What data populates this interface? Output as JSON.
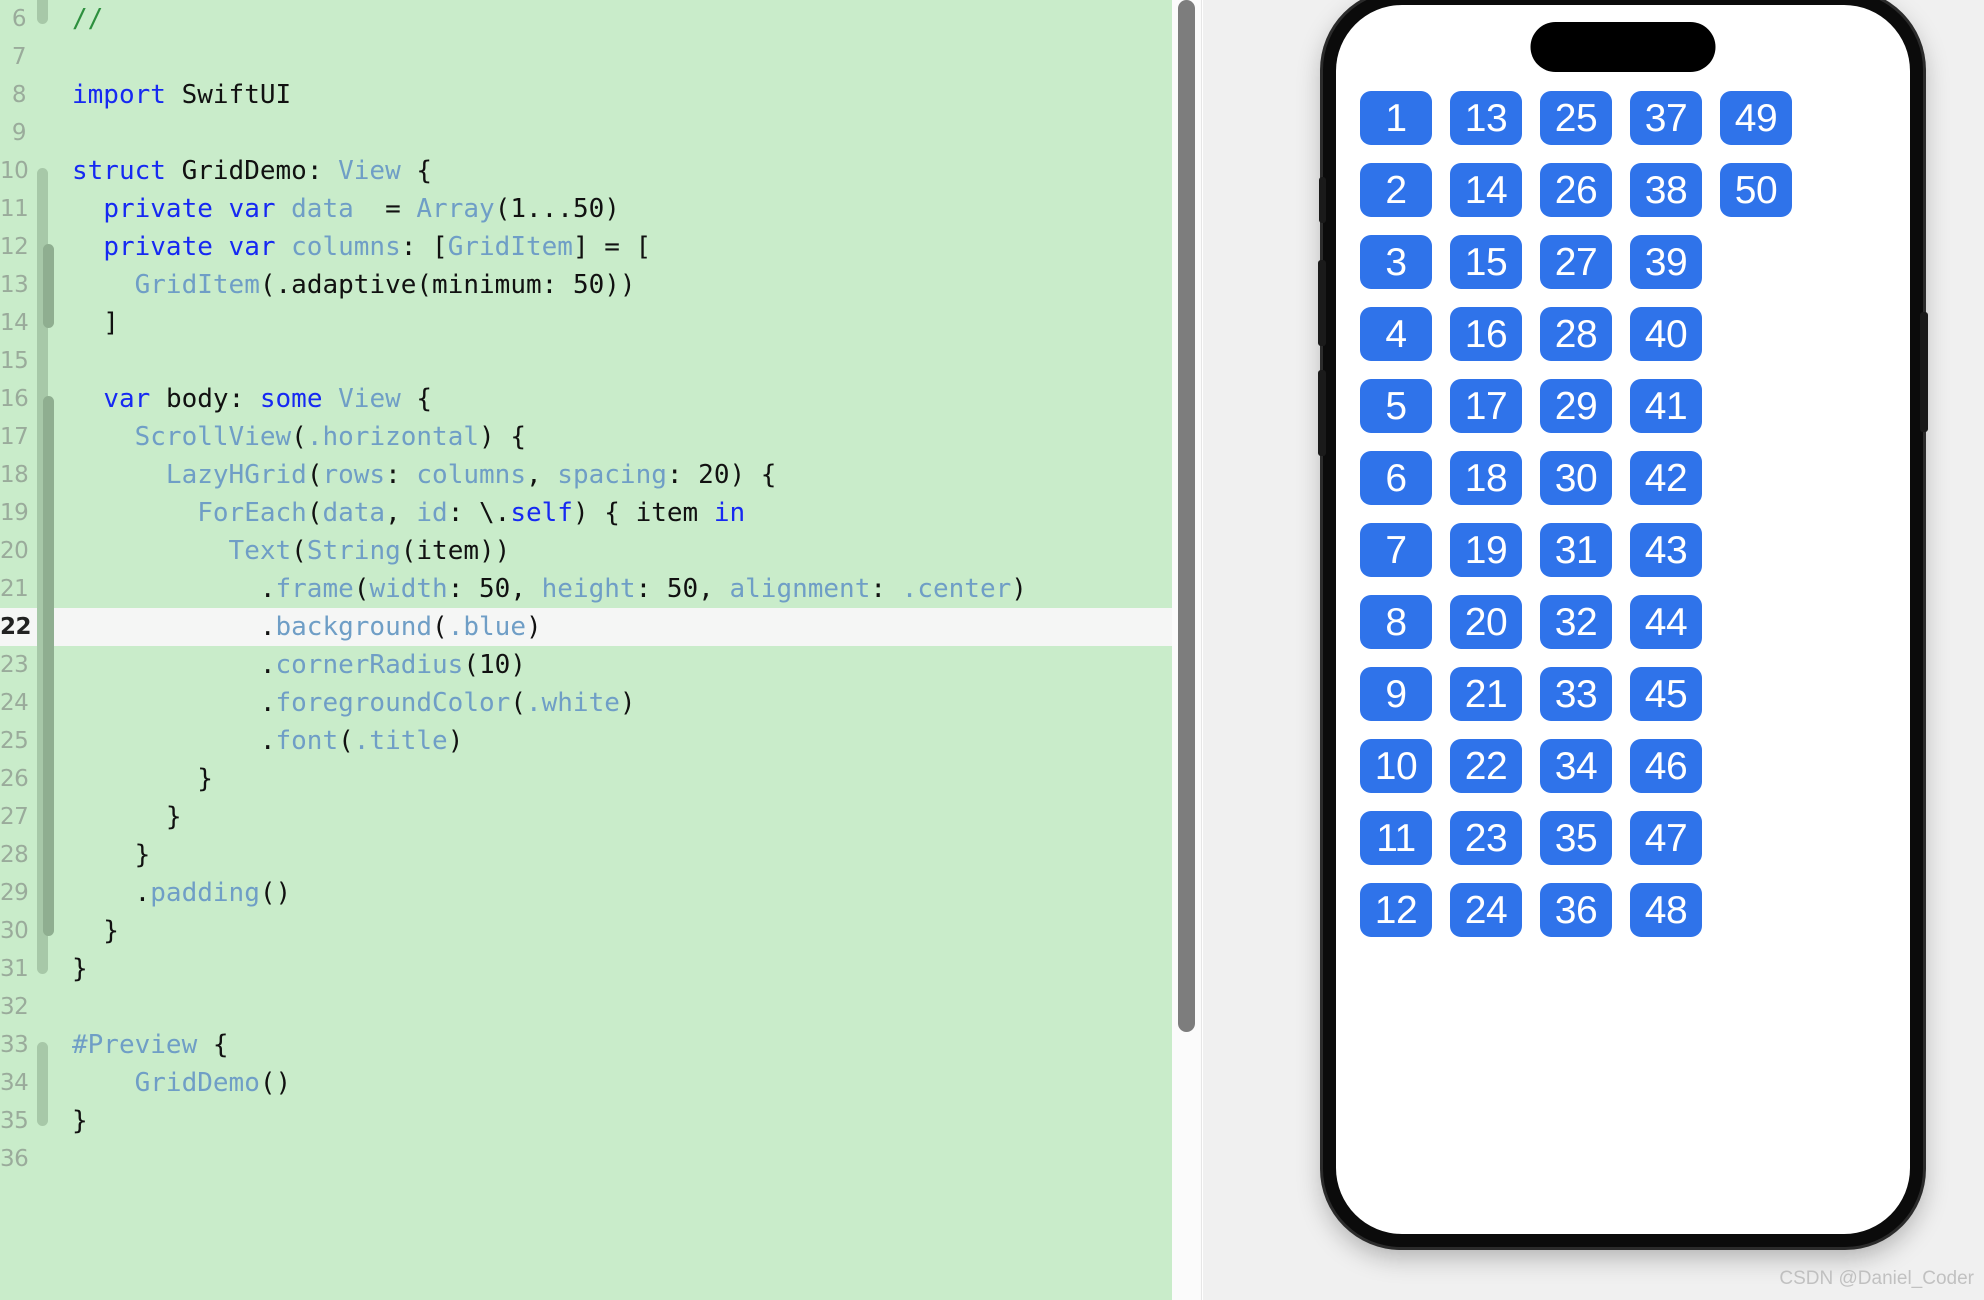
{
  "editor": {
    "first_line_number": 6,
    "highlighted_line": 22,
    "background_color": "#c9ecca",
    "highlight_color": "#f5f6f5",
    "lines": [
      {
        "n": 6,
        "tokens": [
          {
            "t": "//",
            "c": "cm"
          }
        ],
        "guides": [
          "d1-bot"
        ]
      },
      {
        "n": 7,
        "tokens": [],
        "guides": []
      },
      {
        "n": 8,
        "tokens": [
          {
            "t": "import ",
            "c": "kw"
          },
          {
            "t": "SwiftUI",
            "c": "pl"
          }
        ],
        "guides": []
      },
      {
        "n": 9,
        "tokens": [],
        "guides": []
      },
      {
        "n": 10,
        "tokens": [
          {
            "t": "struct ",
            "c": "kw"
          },
          {
            "t": "GridDemo",
            "c": "pl"
          },
          {
            "t": ": ",
            "c": "pl"
          },
          {
            "t": "View",
            "c": "ty"
          },
          {
            "t": " {",
            "c": "pl"
          }
        ],
        "guides": [
          "d1-top"
        ]
      },
      {
        "n": 11,
        "tokens": [
          {
            "t": "  ",
            "c": "pl"
          },
          {
            "t": "private var ",
            "c": "kw"
          },
          {
            "t": "data",
            "c": "ty"
          },
          {
            "t": "  = ",
            "c": "pl"
          },
          {
            "t": "Array",
            "c": "ty"
          },
          {
            "t": "(1...50)",
            "c": "pl"
          }
        ],
        "guides": [
          "d1-mid"
        ]
      },
      {
        "n": 12,
        "tokens": [
          {
            "t": "  ",
            "c": "pl"
          },
          {
            "t": "private var ",
            "c": "kw"
          },
          {
            "t": "columns",
            "c": "ty"
          },
          {
            "t": ": [",
            "c": "pl"
          },
          {
            "t": "GridItem",
            "c": "ty"
          },
          {
            "t": "] = [",
            "c": "pl"
          }
        ],
        "guides": [
          "d1-mid",
          "d2-top"
        ]
      },
      {
        "n": 13,
        "tokens": [
          {
            "t": "    ",
            "c": "pl"
          },
          {
            "t": "GridItem",
            "c": "ty"
          },
          {
            "t": "(.",
            "c": "pl"
          },
          {
            "t": "adaptive",
            "c": "pl"
          },
          {
            "t": "(minimum: 50))",
            "c": "pl"
          }
        ],
        "guides": [
          "d1-mid",
          "d2-mid"
        ]
      },
      {
        "n": 14,
        "tokens": [
          {
            "t": "  ]",
            "c": "pl"
          }
        ],
        "guides": [
          "d1-mid",
          "d2-bot"
        ]
      },
      {
        "n": 15,
        "tokens": [],
        "guides": [
          "d1-mid"
        ]
      },
      {
        "n": 16,
        "tokens": [
          {
            "t": "  ",
            "c": "pl"
          },
          {
            "t": "var ",
            "c": "kw"
          },
          {
            "t": "body",
            "c": "pl"
          },
          {
            "t": ": ",
            "c": "pl"
          },
          {
            "t": "some ",
            "c": "kw"
          },
          {
            "t": "View",
            "c": "ty"
          },
          {
            "t": " {",
            "c": "pl"
          }
        ],
        "guides": [
          "d1-mid",
          "d2-top"
        ]
      },
      {
        "n": 17,
        "tokens": [
          {
            "t": "    ",
            "c": "pl"
          },
          {
            "t": "ScrollView",
            "c": "ty"
          },
          {
            "t": "(",
            "c": "pl"
          },
          {
            "t": ".horizontal",
            "c": "ty"
          },
          {
            "t": ") {",
            "c": "pl"
          }
        ],
        "guides": [
          "d1-mid",
          "d2-mid"
        ]
      },
      {
        "n": 18,
        "tokens": [
          {
            "t": "      ",
            "c": "pl"
          },
          {
            "t": "LazyHGrid",
            "c": "ty"
          },
          {
            "t": "(",
            "c": "pl"
          },
          {
            "t": "rows",
            "c": "ty"
          },
          {
            "t": ": ",
            "c": "pl"
          },
          {
            "t": "columns",
            "c": "ty"
          },
          {
            "t": ", ",
            "c": "pl"
          },
          {
            "t": "spacing",
            "c": "ty"
          },
          {
            "t": ": 20) {",
            "c": "pl"
          }
        ],
        "guides": [
          "d1-mid",
          "d2-mid"
        ]
      },
      {
        "n": 19,
        "tokens": [
          {
            "t": "        ",
            "c": "pl"
          },
          {
            "t": "ForEach",
            "c": "ty"
          },
          {
            "t": "(",
            "c": "pl"
          },
          {
            "t": "data",
            "c": "ty"
          },
          {
            "t": ", ",
            "c": "pl"
          },
          {
            "t": "id",
            "c": "ty"
          },
          {
            "t": ": \\.",
            "c": "pl"
          },
          {
            "t": "self",
            "c": "kw"
          },
          {
            "t": ") { item ",
            "c": "pl"
          },
          {
            "t": "in",
            "c": "kw"
          }
        ],
        "guides": [
          "d1-mid",
          "d2-mid"
        ]
      },
      {
        "n": 20,
        "tokens": [
          {
            "t": "          ",
            "c": "pl"
          },
          {
            "t": "Text",
            "c": "ty"
          },
          {
            "t": "(",
            "c": "pl"
          },
          {
            "t": "String",
            "c": "ty"
          },
          {
            "t": "(item))",
            "c": "pl"
          }
        ],
        "guides": [
          "d1-mid",
          "d2-mid"
        ]
      },
      {
        "n": 21,
        "tokens": [
          {
            "t": "            .",
            "c": "pl"
          },
          {
            "t": "frame",
            "c": "ty"
          },
          {
            "t": "(",
            "c": "pl"
          },
          {
            "t": "width",
            "c": "ty"
          },
          {
            "t": ": 50, ",
            "c": "pl"
          },
          {
            "t": "height",
            "c": "ty"
          },
          {
            "t": ": 50, ",
            "c": "pl"
          },
          {
            "t": "alignment",
            "c": "ty"
          },
          {
            "t": ": ",
            "c": "pl"
          },
          {
            "t": ".center",
            "c": "ty"
          },
          {
            "t": ")",
            "c": "pl"
          }
        ],
        "guides": [
          "d1-mid",
          "d2-mid"
        ]
      },
      {
        "n": 22,
        "tokens": [
          {
            "t": "            .",
            "c": "pl"
          },
          {
            "t": "background",
            "c": "ty"
          },
          {
            "t": "(",
            "c": "pl"
          },
          {
            "t": ".blue",
            "c": "ty"
          },
          {
            "t": ")",
            "c": "pl"
          }
        ],
        "guides": [
          "d1-mid",
          "d2-mid"
        ]
      },
      {
        "n": 23,
        "tokens": [
          {
            "t": "            .",
            "c": "pl"
          },
          {
            "t": "cornerRadius",
            "c": "ty"
          },
          {
            "t": "(10)",
            "c": "pl"
          }
        ],
        "guides": [
          "d1-mid",
          "d2-mid"
        ]
      },
      {
        "n": 24,
        "tokens": [
          {
            "t": "            .",
            "c": "pl"
          },
          {
            "t": "foregroundColor",
            "c": "ty"
          },
          {
            "t": "(",
            "c": "pl"
          },
          {
            "t": ".white",
            "c": "ty"
          },
          {
            "t": ")",
            "c": "pl"
          }
        ],
        "guides": [
          "d1-mid",
          "d2-mid"
        ]
      },
      {
        "n": 25,
        "tokens": [
          {
            "t": "            .",
            "c": "pl"
          },
          {
            "t": "font",
            "c": "ty"
          },
          {
            "t": "(",
            "c": "pl"
          },
          {
            "t": ".title",
            "c": "ty"
          },
          {
            "t": ")",
            "c": "pl"
          }
        ],
        "guides": [
          "d1-mid",
          "d2-mid"
        ]
      },
      {
        "n": 26,
        "tokens": [
          {
            "t": "        }",
            "c": "pl"
          }
        ],
        "guides": [
          "d1-mid",
          "d2-mid"
        ]
      },
      {
        "n": 27,
        "tokens": [
          {
            "t": "      }",
            "c": "pl"
          }
        ],
        "guides": [
          "d1-mid",
          "d2-mid"
        ]
      },
      {
        "n": 28,
        "tokens": [
          {
            "t": "    }",
            "c": "pl"
          }
        ],
        "guides": [
          "d1-mid",
          "d2-mid"
        ]
      },
      {
        "n": 29,
        "tokens": [
          {
            "t": "    .",
            "c": "pl"
          },
          {
            "t": "padding",
            "c": "ty"
          },
          {
            "t": "()",
            "c": "pl"
          }
        ],
        "guides": [
          "d1-mid",
          "d2-mid"
        ]
      },
      {
        "n": 30,
        "tokens": [
          {
            "t": "  }",
            "c": "pl"
          }
        ],
        "guides": [
          "d1-mid",
          "d2-bot"
        ]
      },
      {
        "n": 31,
        "tokens": [
          {
            "t": "}",
            "c": "pl"
          }
        ],
        "guides": [
          "d1-bot"
        ]
      },
      {
        "n": 32,
        "tokens": [],
        "guides": []
      },
      {
        "n": 33,
        "tokens": [
          {
            "t": "#Preview",
            "c": "ty"
          },
          {
            "t": " {",
            "c": "pl"
          }
        ],
        "guides": [
          "d1-top"
        ]
      },
      {
        "n": 34,
        "tokens": [
          {
            "t": "    ",
            "c": "pl"
          },
          {
            "t": "GridDemo",
            "c": "ty"
          },
          {
            "t": "()",
            "c": "pl"
          }
        ],
        "guides": [
          "d1-mid"
        ]
      },
      {
        "n": 35,
        "tokens": [
          {
            "t": "}",
            "c": "pl"
          }
        ],
        "guides": [
          "d1-bot"
        ]
      },
      {
        "n": 36,
        "tokens": [],
        "guides": []
      }
    ]
  },
  "scrollbar": {
    "orientation": "vertical",
    "thumb_color": "#7d7d7d",
    "track_color": "#fbfbfb"
  },
  "preview": {
    "background_color": "#f0f0f0",
    "device": "iPhone",
    "tile_color": "#2f73ea",
    "tile_text_color": "#ffffff",
    "grid": {
      "columns": [
        [
          1,
          2,
          3,
          4,
          5,
          6,
          7,
          8,
          9,
          10,
          11,
          12
        ],
        [
          13,
          14,
          15,
          16,
          17,
          18,
          19,
          20,
          21,
          22,
          23,
          24
        ],
        [
          25,
          26,
          27,
          28,
          29,
          30,
          31,
          32,
          33,
          34,
          35,
          36
        ],
        [
          37,
          38,
          39,
          40,
          41,
          42,
          43,
          44,
          45,
          46,
          47,
          48
        ],
        [
          49,
          50
        ]
      ]
    }
  },
  "watermark": {
    "text": "CSDN @Daniel_Coder"
  }
}
